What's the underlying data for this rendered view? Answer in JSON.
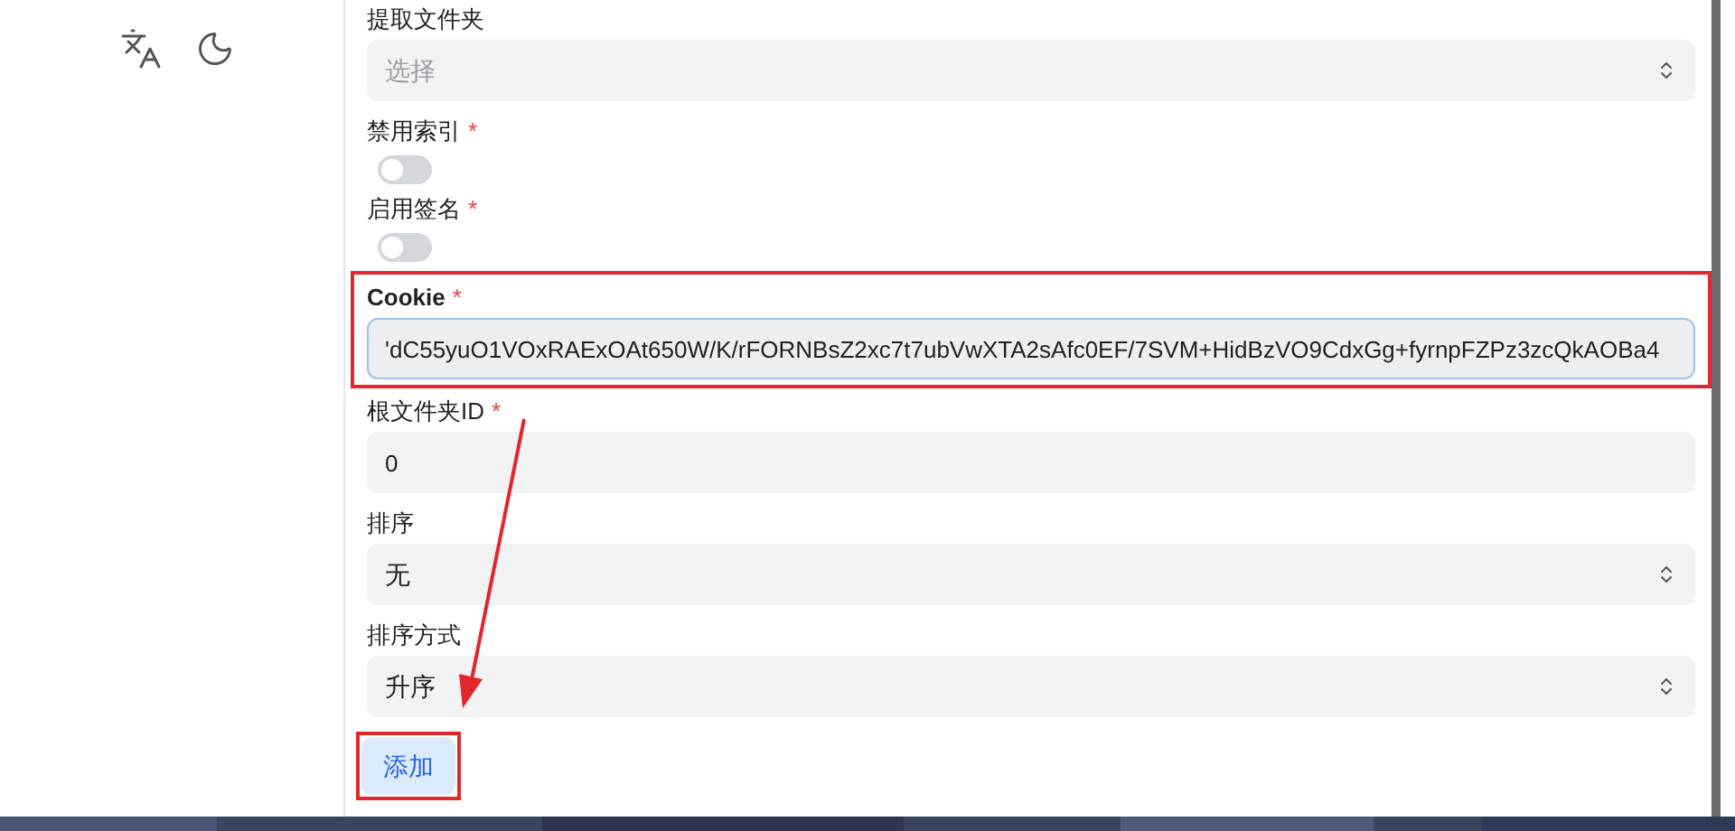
{
  "form": {
    "fields": [
      {
        "kind": "select",
        "label": "提取文件夹",
        "placeholder": "选择",
        "highlighted": false
      },
      {
        "kind": "switch",
        "label": "禁用索引",
        "required_mark": "*",
        "on": false,
        "highlighted": false
      },
      {
        "kind": "switch",
        "label": "启用签名",
        "required_mark": "*",
        "on": false,
        "highlighted": false
      },
      {
        "kind": "text",
        "label": "Cookie",
        "required_mark": "*",
        "value": "'dC55yuO1VOxRAExOAt650W/K/rFORNBsZ2xc7t7ubVwXTA2sAfc0EF/7SVM+HidBzVO9CdxGg+fyrnpFZPz3zcQkAOBa4",
        "highlighted": true,
        "focused": true
      },
      {
        "kind": "text",
        "label": "根文件夹ID",
        "required_mark": "*",
        "value": "0",
        "highlighted": false,
        "focused": false
      },
      {
        "kind": "select",
        "label": "排序",
        "value": "无",
        "highlighted": false
      },
      {
        "kind": "select",
        "label": "排序方式",
        "value": "升序",
        "highlighted": false
      }
    ],
    "submit": {
      "label": "添加",
      "highlighted": true
    }
  }
}
